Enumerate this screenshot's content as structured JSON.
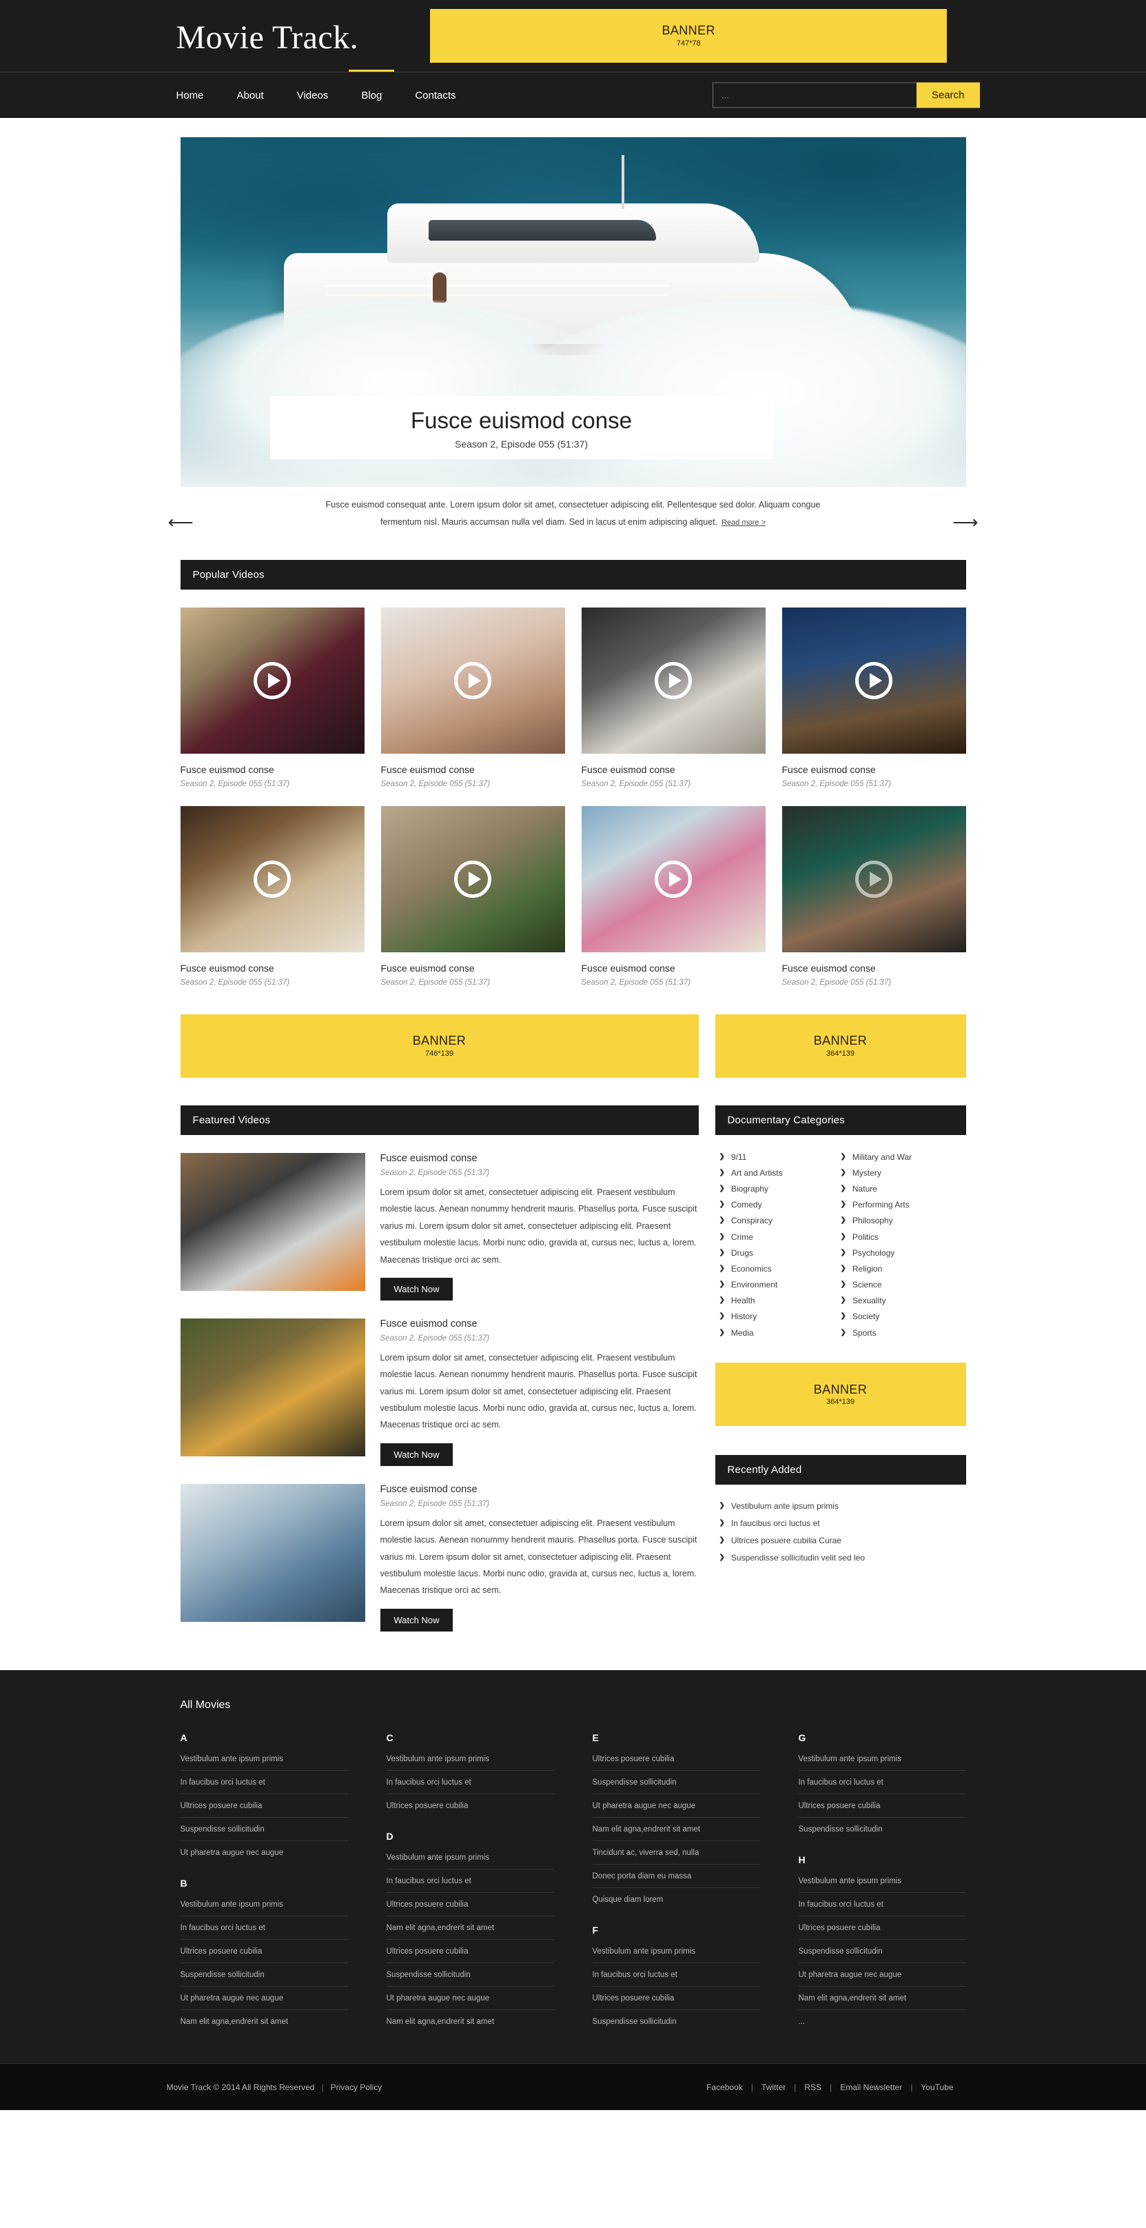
{
  "brand": {
    "logo": "Movie Track."
  },
  "header": {
    "banner": {
      "title": "BANNER",
      "size": "747*78"
    },
    "nav": [
      {
        "label": "Home"
      },
      {
        "label": "About"
      },
      {
        "label": "Videos"
      },
      {
        "label": "Blog"
      },
      {
        "label": "Contacts"
      }
    ],
    "search": {
      "value": "",
      "placeholder": "...",
      "button": "Search"
    }
  },
  "hero": {
    "title": "Fusce euismod conse",
    "subtitle": "Season 2, Episode 055  (51:37)",
    "description": "Fusce euismod consequat ante. Lorem ipsum dolor sit amet, consectetuer adipiscing elit. Pellentesque sed dolor. Aliquam congue fermentum nisl. Mauris accumsan nulla vel diam. Sed in lacus ut enim adipiscing aliquet.",
    "read_more": "Read more >",
    "prev_arrow": "⟵",
    "next_arrow": "⟶"
  },
  "popular": {
    "heading": "Popular Videos",
    "items": [
      {
        "title": "Fusce euismod conse",
        "meta": "Season 2, Episode 055  (51:37)"
      },
      {
        "title": "Fusce euismod conse",
        "meta": "Season 2, Episode 055  (51:37)"
      },
      {
        "title": "Fusce euismod conse",
        "meta": "Season 2, Episode 055  (51:37)"
      },
      {
        "title": "Fusce euismod conse",
        "meta": "Season 2, Episode 055  (51:37)"
      },
      {
        "title": "Fusce euismod conse",
        "meta": "Season 2, Episode 055  (51:37)"
      },
      {
        "title": "Fusce euismod conse",
        "meta": "Season 2, Episode 055  (51:37)"
      },
      {
        "title": "Fusce euismod conse",
        "meta": "Season 2, Episode 055  (51:37)"
      },
      {
        "title": "Fusce euismod conse",
        "meta": "Season 2, Episode 055  (51:37)"
      }
    ]
  },
  "banners": {
    "mid_left": {
      "title": "BANNER",
      "size": "746*139"
    },
    "mid_right": {
      "title": "BANNER",
      "size": "364*139"
    },
    "side": {
      "title": "BANNER",
      "size": "364*139"
    }
  },
  "featured": {
    "heading": "Featured Videos",
    "watch_label": "Watch Now",
    "items": [
      {
        "title": "Fusce euismod conse",
        "meta": "Season 2, Episode 055  (51:37)",
        "text": "Lorem ipsum dolor sit amet, consectetuer adipiscing elit. Praesent vestibulum molestie lacus. Aenean nonummy hendrerit mauris. Phasellus porta. Fusce suscipit varius mi. Lorem ipsum dolor sit amet, consectetuer adipiscing elit. Praesent vestibulum molestie lacus. Morbi nunc odio, gravida at, cursus nec, luctus a, lorem. Maecenas tristique orci ac sem."
      },
      {
        "title": "Fusce euismod conse",
        "meta": "Season 2, Episode 055  (51:37)",
        "text": "Lorem ipsum dolor sit amet, consectetuer adipiscing elit. Praesent vestibulum molestie lacus. Aenean nonummy hendrerit mauris. Phasellus porta. Fusce suscipit varius mi. Lorem ipsum dolor sit amet, consectetuer adipiscing elit. Praesent vestibulum molestie lacus. Morbi nunc odio, gravida at, cursus nec, luctus a, lorem. Maecenas tristique orci ac sem."
      },
      {
        "title": "Fusce euismod conse",
        "meta": "Season 2, Episode 055  (51:37)",
        "text": "Lorem ipsum dolor sit amet, consectetuer adipiscing elit. Praesent vestibulum molestie lacus. Aenean nonummy hendrerit mauris. Phasellus porta. Fusce suscipit varius mi. Lorem ipsum dolor sit amet, consectetuer adipiscing elit. Praesent vestibulum molestie lacus. Morbi nunc odio, gravida at, cursus nec, luctus a, lorem. Maecenas tristique orci ac sem."
      }
    ]
  },
  "categories": {
    "heading": "Documentary Categories",
    "chevron": "❯",
    "left": [
      "9/11",
      "Art and Artists",
      "Biography",
      "Comedy",
      "Conspiracy",
      "Crime",
      "Drugs",
      "Economics",
      "Environment",
      "Health",
      "History",
      "Media"
    ],
    "right": [
      "Military and War",
      "Mystery",
      "Nature",
      "Performing Arts",
      "Philosophy",
      "Politics",
      "Psychology",
      "Religion",
      "Science",
      "Sexuality",
      "Society",
      "Sports"
    ]
  },
  "recent": {
    "heading": "Recently Added",
    "chevron": "❯",
    "items": [
      "Vestibulum ante ipsum primis",
      "In faucibus orci luctus et",
      "Ultrices posuere cubilia Curae",
      "Suspendisse sollicitudin velit sed leo"
    ]
  },
  "footer": {
    "title": "All Movies",
    "columns": [
      {
        "groups": [
          {
            "letter": "A",
            "links": [
              "Vestibulum ante ipsum primis",
              "In faucibus orci luctus et",
              "Ultrices posuere cubilia",
              "Suspendisse sollicitudin",
              "Ut pharetra augue nec augue"
            ]
          },
          {
            "letter": "B",
            "links": [
              "Vestibulum ante ipsum primis",
              "In faucibus orci luctus et",
              "Ultrices posuere cubilia",
              "Suspendisse sollicitudin",
              "Ut pharetra augue nec augue",
              "Nam elit agna,endrerit sit amet"
            ]
          }
        ]
      },
      {
        "groups": [
          {
            "letter": "C",
            "links": [
              "Vestibulum ante ipsum primis",
              "In faucibus orci luctus et",
              "Ultrices posuere cubilia"
            ]
          },
          {
            "letter": "D",
            "links": [
              "Vestibulum ante ipsum primis",
              "In faucibus orci luctus et",
              "Ultrices posuere cubilia",
              "Nam elit agna,endrerit sit amet",
              "Ultrices posuere cubilia",
              "Suspendisse sollicitudin",
              "Ut pharetra augue nec augue",
              "Nam elit agna,endrerit sit amet"
            ]
          }
        ]
      },
      {
        "groups": [
          {
            "letter": "E",
            "links": [
              "Ultrices posuere cubilia",
              "Suspendisse sollicitudin",
              "Ut pharetra augue nec augue",
              "Nam elit agna,endrerit sit amet",
              "Tincidunt ac, viverra sed, nulla",
              "Donec porta diam eu massa",
              "Quisque diam lorem"
            ]
          },
          {
            "letter": "F",
            "links": [
              "Vestibulum ante ipsum primis",
              "In faucibus orci luctus et",
              "Ultrices posuere cubilia",
              "Suspendisse sollicitudin"
            ]
          }
        ]
      },
      {
        "groups": [
          {
            "letter": "G",
            "links": [
              "Vestibulum ante ipsum primis",
              "In faucibus orci luctus et",
              "Ultrices posuere cubilia",
              "Suspendisse sollicitudin"
            ]
          },
          {
            "letter": "H",
            "links": [
              "Vestibulum ante ipsum primis",
              "In faucibus orci luctus et",
              "Ultrices posuere cubilia",
              "Suspendisse sollicitudin",
              "Ut pharetra augue nec augue",
              "Nam elit agna,endrerit sit amet",
              "..."
            ]
          }
        ]
      }
    ],
    "copyright": "Movie Track © 2014 All Rights Reserved",
    "privacy": "Privacy Policy",
    "separator": "|",
    "social": [
      "Facebook",
      "Twitter",
      "RSS",
      "Email Newsletter",
      "YouTube"
    ]
  },
  "colors": {
    "accent": "#f8d53e",
    "dark": "#1c1c1c",
    "text": "#3d3d3d"
  }
}
